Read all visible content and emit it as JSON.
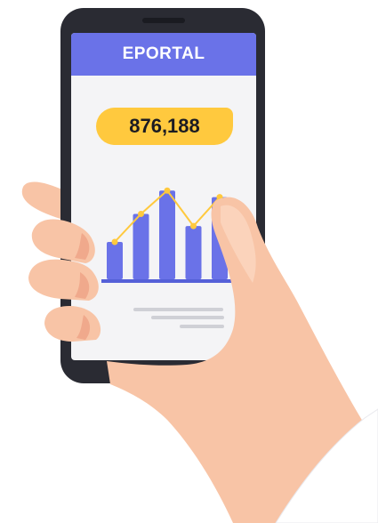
{
  "app": {
    "title": "EPORTAL"
  },
  "balance": {
    "value": "876,188"
  },
  "chart_data": {
    "type": "bar",
    "categories": [
      "",
      "",
      "",
      "",
      ""
    ],
    "values": [
      40,
      70,
      95,
      57,
      88
    ],
    "line_overlay": [
      40,
      70,
      95,
      57,
      88
    ],
    "ylim": [
      0,
      100
    ],
    "grid": false,
    "colors": {
      "bar": "#6a72e8",
      "line": "#ffc93e",
      "baseline": "#5560d8"
    }
  },
  "colors": {
    "phone_body": "#2a2b33",
    "header": "#6a72e8",
    "accent": "#ffc93e",
    "skin": "#f8c4a6",
    "skin_shadow": "#f0a98c",
    "sleeve": "#ffffff"
  },
  "icons": {
    "hand": "hand-illustration",
    "phone": "smartphone"
  }
}
